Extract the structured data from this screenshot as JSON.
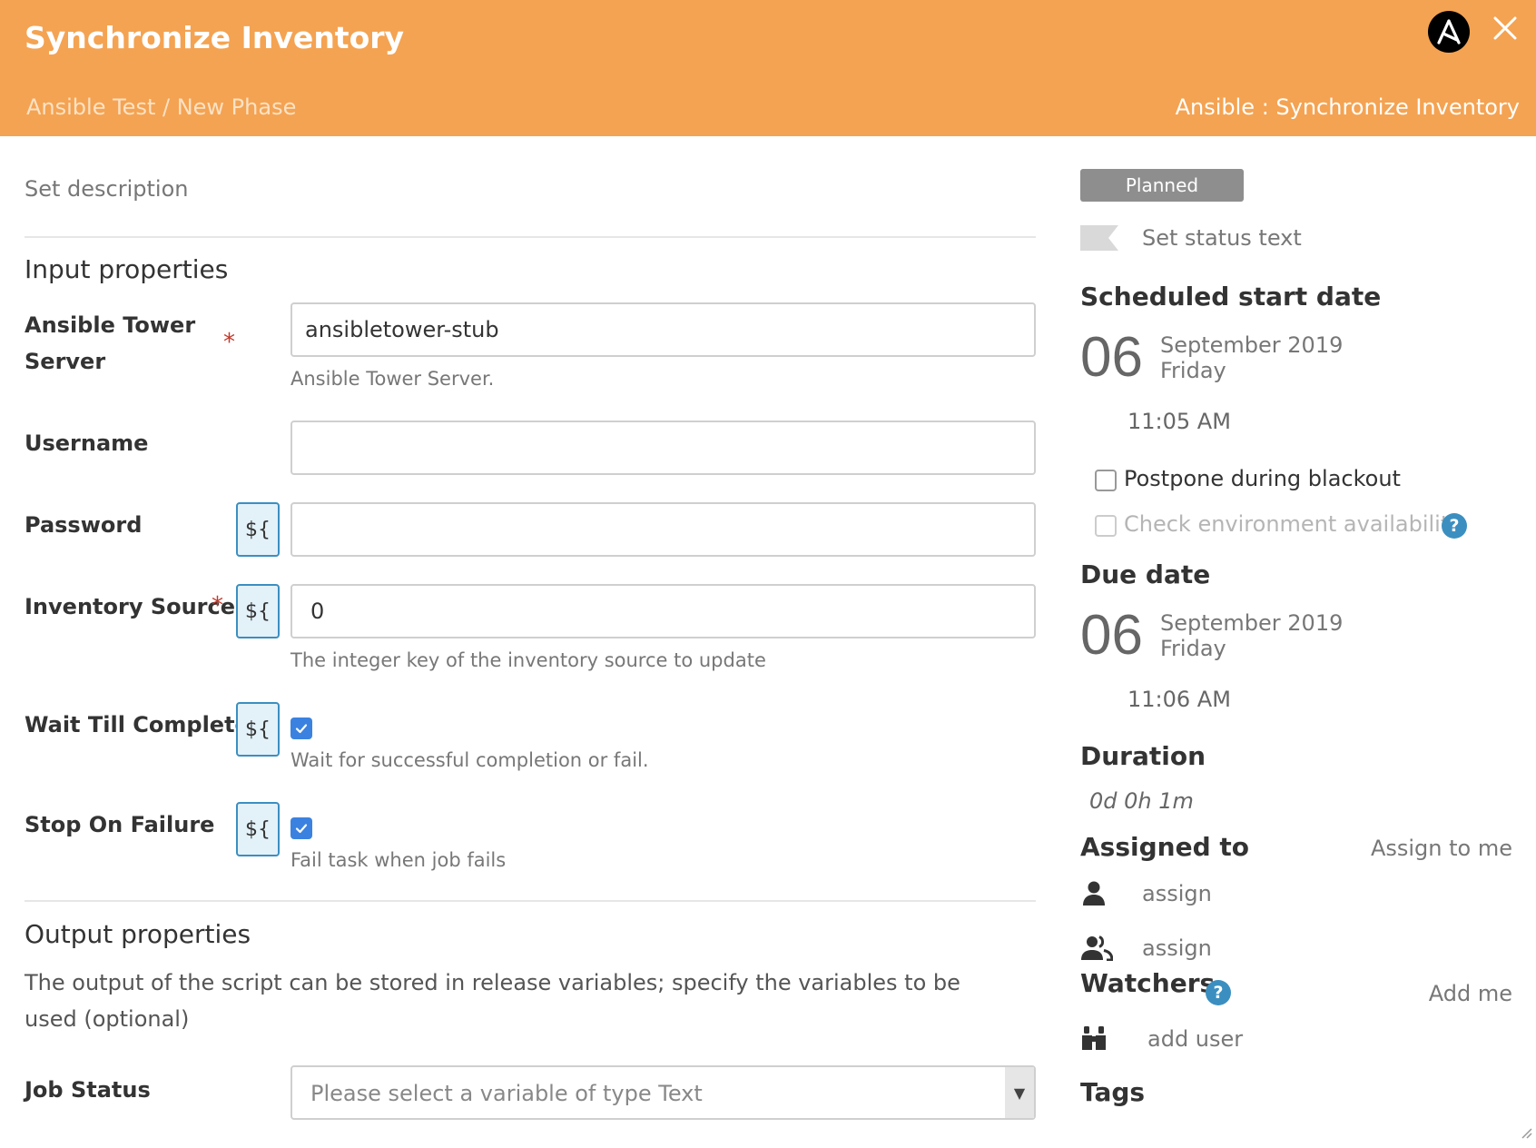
{
  "header": {
    "title": "Synchronize Inventory",
    "breadcrumb": "Ansible Test / New Phase",
    "task_type": "Ansible : Synchronize Inventory"
  },
  "main": {
    "description_placeholder": "Set description",
    "input_title": "Input properties",
    "variable_button_label": "${",
    "fields": {
      "server": {
        "label": "Ansible Tower Server",
        "value": "ansibletower-stub",
        "help": "Ansible Tower Server."
      },
      "username": {
        "label": "Username",
        "value": ""
      },
      "password": {
        "label": "Password",
        "value": ""
      },
      "inventory": {
        "label": "Inventory Source",
        "value": "0",
        "help": "The integer key of the inventory source to update"
      },
      "wait": {
        "label": "Wait Till Complete",
        "checked": true,
        "help": "Wait for successful completion or fail."
      },
      "stop": {
        "label": "Stop On Failure",
        "checked": true,
        "help": "Fail task when job fails"
      }
    },
    "output_title": "Output properties",
    "output_description": "The output of the script can be stored in release variables; specify the variables to be used (optional)",
    "job_status": {
      "label": "Job Status",
      "placeholder": "Please select a variable of type Text"
    }
  },
  "sidebar": {
    "status": "Planned",
    "status_text_placeholder": "Set status text",
    "scheduled": {
      "title": "Scheduled start date",
      "day": "06",
      "month_year": "September 2019",
      "weekday": "Friday",
      "time": "11:05 AM"
    },
    "postpone_label": "Postpone during blackout",
    "check_env_label": "Check environment availability",
    "due": {
      "title": "Due date",
      "day": "06",
      "month_year": "September 2019",
      "weekday": "Friday",
      "time": "11:06 AM"
    },
    "duration": {
      "title": "Duration",
      "value": "0d 0h 1m"
    },
    "assigned": {
      "title": "Assigned to",
      "assign_to_me": "Assign to me",
      "user_placeholder": "assign",
      "team_placeholder": "assign"
    },
    "watchers": {
      "title": "Watchers",
      "add_me": "Add me",
      "add_user": "add user"
    },
    "tags": {
      "title": "Tags"
    }
  },
  "colors": {
    "header": "#f4a352",
    "accent": "#3b8fc0",
    "checkbox": "#3b82e0",
    "required": "#c0392b",
    "status_badge": "#8e8e8e"
  }
}
